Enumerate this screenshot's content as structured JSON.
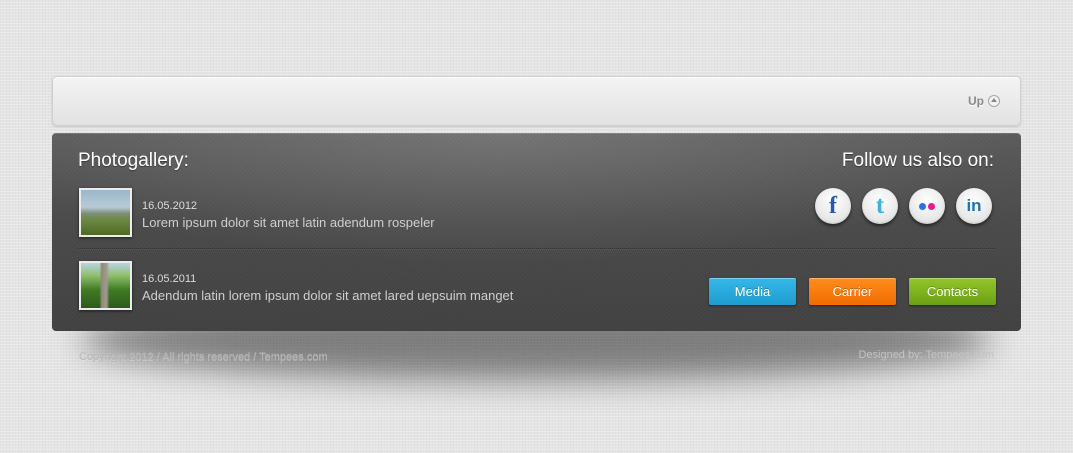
{
  "top_bar": {
    "up_label": "Up",
    "up_icon": "circle-arrow-up-icon"
  },
  "gallery": {
    "title": "Photogallery:",
    "posts": [
      {
        "date": "16.05.2012",
        "text": "Lorem ipsum dolor sit amet latin adendum rospeler",
        "thumbnail": "landscape-photo"
      },
      {
        "date": "16.05.2011",
        "text": "Adendum latin lorem ipsum dolor sit amet lared uepsuim manget",
        "thumbnail": "green-path-photo"
      }
    ]
  },
  "social": {
    "title": "Follow us also on:",
    "icons": [
      {
        "name": "facebook-icon",
        "glyph": "f",
        "color": "#2a5aa5"
      },
      {
        "name": "twitter-icon",
        "glyph": "t",
        "color": "#3fb0e0"
      },
      {
        "name": "flickr-icon",
        "colors": [
          "#2b73d8",
          "#f0168c"
        ]
      },
      {
        "name": "linkedin-icon",
        "glyph": "in",
        "color": "#1f73b0"
      }
    ]
  },
  "buttons": {
    "media": {
      "label": "Media",
      "color": "#1e9ccf"
    },
    "carrier": {
      "label": "Carrier",
      "color": "#f06c00"
    },
    "contacts": {
      "label": "Contacts",
      "color": "#6da014"
    }
  },
  "footer": {
    "copyright": "Copyright 2012 / All rights reserved / Tempees.com",
    "designed_by": "Designed by: Tempees.com"
  }
}
